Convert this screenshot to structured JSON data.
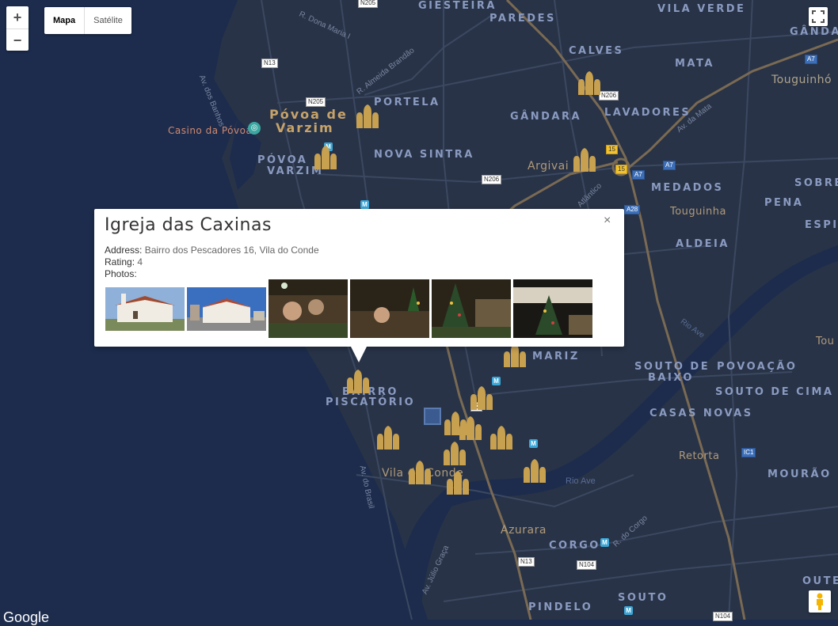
{
  "controls": {
    "zoom_in": "+",
    "zoom_out": "−",
    "map_type": [
      "Mapa",
      "Satélite"
    ],
    "active_map_type": "Mapa",
    "fullscreen_icon": "fullscreen-icon",
    "pegman_icon": "pegman-icon"
  },
  "map_labels": {
    "giesteira": "GIESTEIRA",
    "paredes": "PAREDES",
    "vila_verde": "VILA VERDE",
    "gandara_top": "GÂNDARA",
    "calves": "CALVES",
    "mata": "MATA",
    "touguinho": "Touguinhó",
    "portela": "PORTELA",
    "povoa_de_varzim_line1": "Póvoa de",
    "povoa_de_varzim_line2": "Varzim",
    "casino": "Casino da Póvoa",
    "gandara": "GÂNDARA",
    "lavadores": "LAVADORES",
    "povoa_varzim_line1": "PÓVOA",
    "povoa_varzim_line2": "VARZIM",
    "nova_sintra": "NOVA SINTRA",
    "argivai": "Argivai",
    "medados": "MEDADOS",
    "sobre": "SOBRE",
    "pena": "PENA",
    "touguinha": "Touguinha",
    "espi": "ESPI",
    "aldeia": "ALDEIA",
    "tou": "Tou",
    "mariz": "MARIZ",
    "souto_de_baixo_line1": "SOUTO DE",
    "souto_de_baixo_line2": "BAIXO",
    "povoacao": "POVOAÇÃO",
    "souto_de_cima": "SOUTO DE CIMA",
    "bairro_line1": "BAIRRO",
    "bairro_line2": "PISCATÓRIO",
    "casas_novas": "CASAS NOVAS",
    "retorta": "Retorta",
    "vila_do_conde": "Vila do Conde",
    "mourao": "MOURÃO",
    "azurara": "Azurara",
    "corgo": "CORGO",
    "oute": "OUTE",
    "souto": "SOUTO",
    "pindelo": "PINDELO",
    "rio_ave_1": "Rio Ave",
    "rio_ave_2": "Rio Ave"
  },
  "streets": {
    "dona_maria": "R. Dona Maria I",
    "almeida_brandao": "R. Almeida Brandão",
    "av_banhos": "Av. dos Banhos",
    "av_mata": "Av. da Mata",
    "atlantico": "Atlântico",
    "av_brasil": "Av. do Brasil",
    "r_corgo": "R. do Corgo",
    "av_julio_graca": "Av. Júlio Graça"
  },
  "road_shields": {
    "n205_top": "N205",
    "n13_top": "N13",
    "n205": "N205",
    "n206_top": "N206",
    "a7_top": "A7",
    "n15a": "15",
    "n15b": "15",
    "a7_mid": "A7",
    "a7_mid2": "A7",
    "n206": "N206",
    "a28": "A28",
    "n13_mid": "13",
    "ic1": "IC1",
    "n13_bottom": "N13",
    "n104": "N104",
    "n104_b": "N104"
  },
  "metro_icon": "metro-icon",
  "church_icon": "church-icon",
  "info_window": {
    "title": "Igreja das Caxinas",
    "close": "×",
    "address_label": "Address:",
    "address_value": "Bairro dos Pescadores 16, Vila do Conde",
    "rating_label": "Rating:",
    "rating_value": "4",
    "photos_label": "Photos:"
  },
  "attribution": "Google",
  "colors": {
    "water": "#1d2c4d",
    "land": "#2a3650",
    "roads": "#3e4b63",
    "highway": "#7a6a53",
    "church": "#c7a050"
  }
}
